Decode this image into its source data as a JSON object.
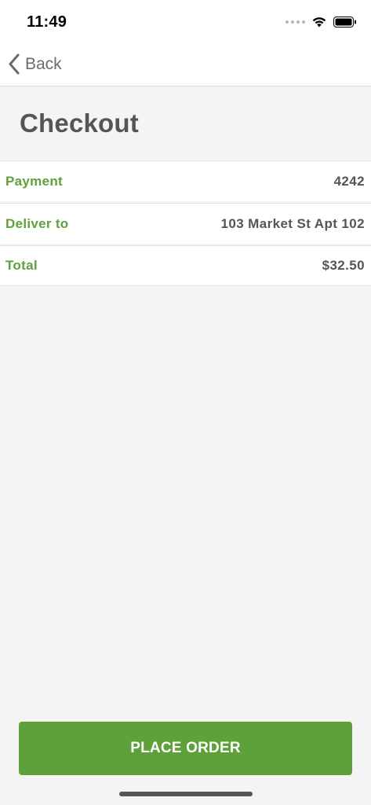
{
  "status_bar": {
    "time": "11:49"
  },
  "nav": {
    "back_label": "Back"
  },
  "page": {
    "title": "Checkout"
  },
  "summary": [
    {
      "label": "Payment",
      "value": "4242"
    },
    {
      "label": "Deliver to",
      "value": "103 Market St Apt 102"
    },
    {
      "label": "Total",
      "value": "$32.50"
    }
  ],
  "actions": {
    "place_order_label": "PLACE ORDER"
  },
  "colors": {
    "accent_green": "#5ea13a",
    "text_gray": "#555555",
    "background": "#f4f4f4"
  }
}
